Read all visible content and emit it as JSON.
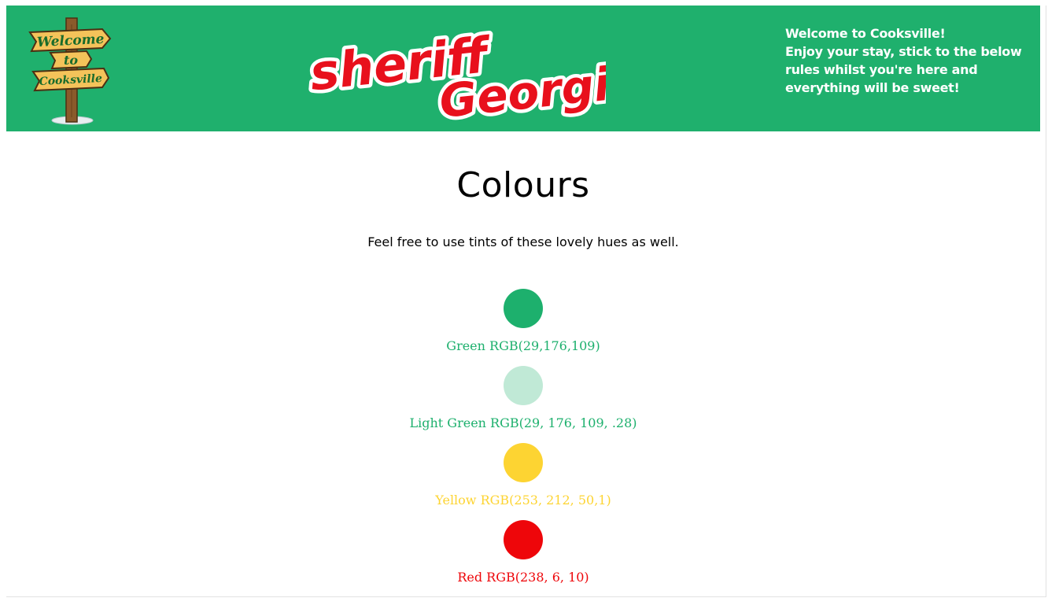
{
  "header": {
    "sign_logo": {
      "lines": [
        "Welcome",
        "to",
        "Cooksville"
      ]
    },
    "brand_logo": {
      "word1": "sheriff",
      "word2": "Georgie"
    },
    "welcome_title": "Welcome to Cooksville!",
    "welcome_body": "Enjoy your stay, stick to the below rules whilst you're here and everything will be sweet!"
  },
  "main": {
    "title": "Colours",
    "intro": "Feel free to use tints of these lovely hues as well.",
    "swatches": [
      {
        "label": "Green RGB(29,176,109)",
        "color": "#1db06d",
        "text_color": "#1db06d"
      },
      {
        "label": "Light Green RGB(29, 176, 109, .28)",
        "color": "rgba(29,176,109,0.28)",
        "text_color": "#1db06d"
      },
      {
        "label": "Yellow RGB(253, 212, 50,1)",
        "color": "#fdd432",
        "text_color": "#fdd432"
      },
      {
        "label": "Red RGB(238, 6, 10)",
        "color": "#ee060a",
        "text_color": "#ee060a"
      }
    ]
  },
  "colors": {
    "header_background": "#1fb06d",
    "logo_red": "#e8101c",
    "sign_wood": "#f4c35a",
    "sign_text": "#1a6b2b"
  }
}
